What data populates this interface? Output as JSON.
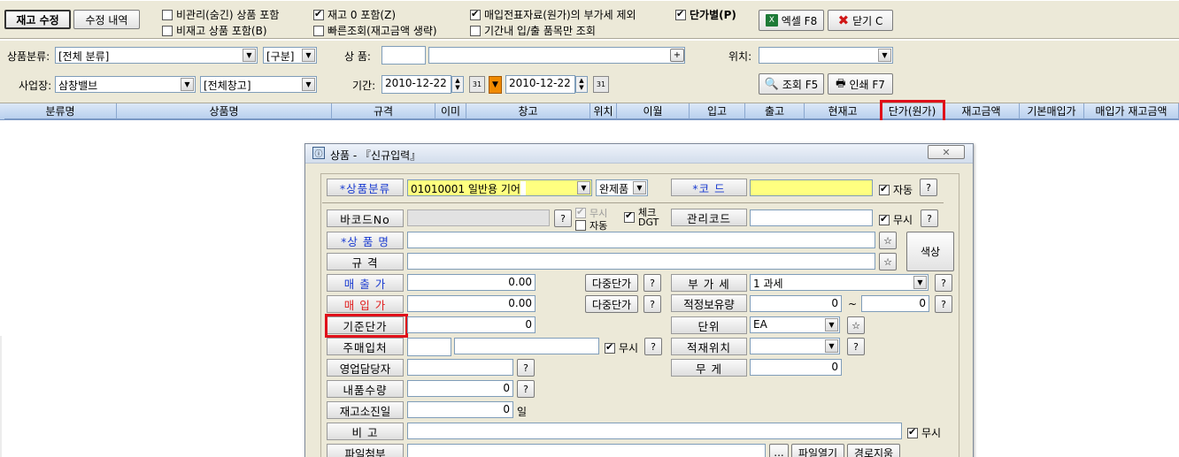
{
  "toolbar": {
    "edit_inventory": "재고 수정",
    "edit_history": "수정 내역",
    "excel": "엑셀 F8",
    "close": "닫기 C",
    "query": "조회 F5",
    "print": "인쇄 F7",
    "checks": [
      {
        "label": "비관리(숨긴) 상품 포함",
        "checked": false
      },
      {
        "label": "비재고 상품 포함(B)",
        "checked": false
      },
      {
        "label": "재고 0 포함(Z)",
        "checked": true
      },
      {
        "label": "빠른조회(재고금액 생략)",
        "checked": false
      },
      {
        "label": "매입전표자료(원가)의 부가세 제외",
        "checked": true
      },
      {
        "label": "기간내 입/출 품목만 조회",
        "checked": false
      },
      {
        "label": "단가별(P)",
        "checked": true
      }
    ]
  },
  "filters": {
    "category_label": "상품분류:",
    "category_value": "[전체 분류]",
    "division_value": "[구분]",
    "product_label": "상 품:",
    "location_label": "위치:",
    "site_label": "사업장:",
    "site_value": "삼창밸브",
    "warehouse_value": "[전체창고]",
    "period_label": "기간:",
    "date_from": "2010-12-22",
    "date_to": "2010-12-22",
    "spin_up": "▲",
    "spin_down": "▼",
    "calendar": "31",
    "period_marker": "▼"
  },
  "grid": {
    "columns": [
      "분류명",
      "상품명",
      "규격",
      "이미",
      "창고",
      "위치",
      "이월",
      "입고",
      "출고",
      "현재고",
      "단가(원가)",
      "재고금액",
      "기본매입가",
      "매입가 재고금액"
    ]
  },
  "dialog": {
    "title": "상품 - 『신규입력』",
    "close": "✕",
    "category_label": "*상품분류",
    "category_value": "01010001 일반용 기어",
    "type_value": "완제품",
    "code_label": "*코   드",
    "auto_label": "자동",
    "barcode_label": "바코드No",
    "ignore_label": "무시",
    "auto_small": "자동",
    "check_dgt_label_1": "체크",
    "check_dgt_label_2": "DGT",
    "manage_code_label": "관리코드",
    "product_name_label": "*상 품 명",
    "spec_label": "규   격",
    "color_label": "색상",
    "sale_price_label": "매 출 가",
    "sale_price_value": "0.00",
    "buy_price_label": "매 입 가",
    "buy_price_value": "0.00",
    "multi_price": "다중단가",
    "vat_label": "부 가 세",
    "vat_value": "1 과세",
    "proper_stock_label": "적정보유량",
    "proper_stock_from": "0",
    "proper_stock_to": "0",
    "tilde": "~",
    "base_price_label": "기준단가",
    "base_price_value": "0",
    "unit_label": "단위",
    "unit_value": "EA",
    "main_supplier_label": "주매입처",
    "location_label": "적재위치",
    "sales_manager_label": "영업담당자",
    "weight_label": "무   게",
    "weight_value": "0",
    "delivery_qty_label": "내품수량",
    "delivery_qty_value": "0",
    "exhaust_label": "재고소진일",
    "exhaust_value": "0",
    "day_label": "일",
    "note_label": "비   고",
    "attach_label": "파일첨부",
    "ellipsis": "...",
    "open_file": "파일열기",
    "clear_path": "경로지움",
    "question": "?",
    "star": "☆",
    "plus": "+"
  }
}
